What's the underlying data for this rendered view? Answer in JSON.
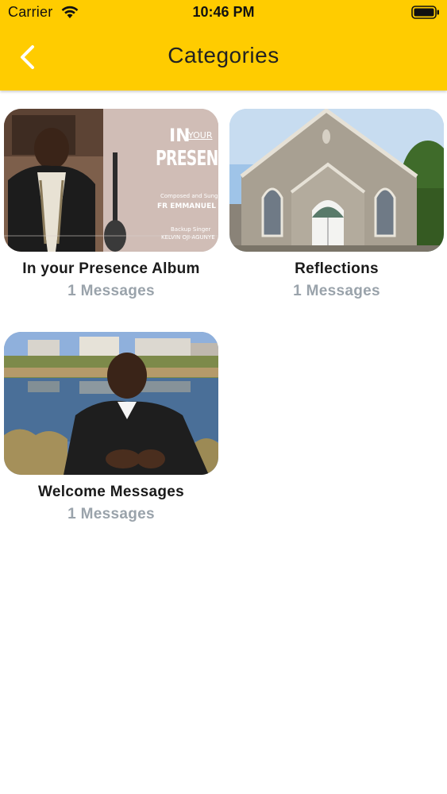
{
  "status_bar": {
    "carrier": "Carrier",
    "time": "10:46 PM"
  },
  "nav": {
    "title": "Categories",
    "back_icon": "chevron-left-icon"
  },
  "colors": {
    "header": "#FFCC00",
    "title_text": "#1a1a1a",
    "count_text": "#9aa3ab"
  },
  "categories": [
    {
      "title": "In your Presence Album",
      "count": "1 Messages",
      "thumb_text": {
        "line1": "IN",
        "line1b": "YOUR",
        "line2": "PRESENCE",
        "line3": "Composed and Sung by",
        "line4": "FR EMMANUEL OKAN",
        "line5": "Backup Singer",
        "line6": "KELVIN OJI-AGUNYE"
      }
    },
    {
      "title": "Reflections",
      "count": "1 Messages"
    },
    {
      "title": "Welcome Messages",
      "count": "1 Messages"
    }
  ]
}
